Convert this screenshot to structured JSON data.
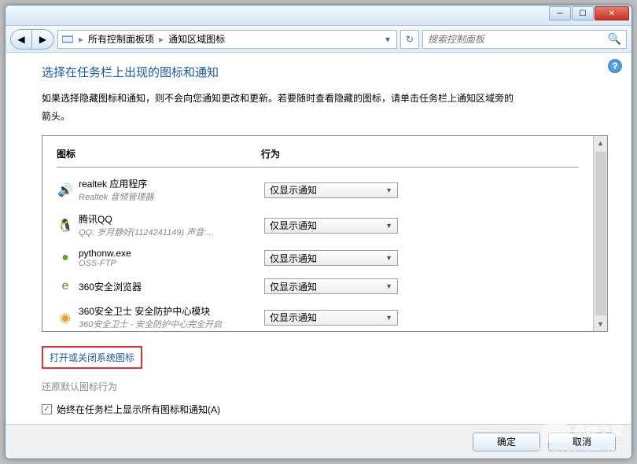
{
  "breadcrumb": {
    "item1": "所有控制面板项",
    "item2": "通知区域图标"
  },
  "search": {
    "placeholder": "搜索控制面板"
  },
  "page": {
    "title": "选择在任务栏上出现的图标和通知",
    "desc1": "如果选择隐藏图标和通知，则不会向您通知更改和更新。若要随时查看隐藏的图标，请单击任务栏上通知区域旁的",
    "desc2": "箭头。"
  },
  "columns": {
    "icon": "图标",
    "behavior": "行为"
  },
  "icons": [
    {
      "icon_name": "speaker-icon",
      "glyph": "🔊",
      "color": "#1aa33a",
      "title": "realtek 应用程序",
      "sub": "Realtek 音频管理器",
      "behavior": "仅显示通知"
    },
    {
      "icon_name": "qq-icon",
      "glyph": "🐧",
      "color": "#000",
      "title": "腾讯QQ",
      "sub": "QQ: 岁月静好(1124241149)   声音:...",
      "behavior": "仅显示通知"
    },
    {
      "icon_name": "python-icon",
      "glyph": "●",
      "color": "#6aa329",
      "title": "pythonw.exe",
      "sub": "OSS-FTP",
      "behavior": "仅显示通知"
    },
    {
      "icon_name": "browser-icon",
      "glyph": "e",
      "color": "#4aa31a",
      "title": "360安全浏览器",
      "sub": "",
      "behavior": "仅显示通知"
    },
    {
      "icon_name": "shield-icon",
      "glyph": "◉",
      "color": "#f0a020",
      "title": "360安全卫士 安全防护中心模块",
      "sub": "360安全卫士 - 安全防护中心完全开启",
      "behavior": "仅显示通知"
    }
  ],
  "links": {
    "toggle_sys": "打开或关闭系统图标",
    "restore": "还原默认图标行为"
  },
  "checkbox": {
    "label": "始终在任务栏上显示所有图标和通知(A)"
  },
  "buttons": {
    "ok": "确定",
    "cancel": "取消"
  },
  "watermark": {
    "text": "系统之家",
    "sub": "XITONGZHIJIA.NET"
  }
}
